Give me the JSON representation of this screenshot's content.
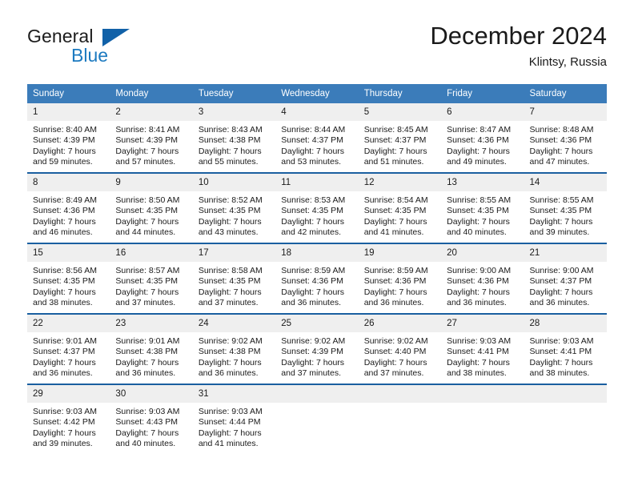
{
  "brand": {
    "name_part1": "General",
    "name_part2": "Blue",
    "colors": {
      "text": "#1c1c1c",
      "blue": "#1c7ac0",
      "triangle": "#1161a8"
    }
  },
  "header": {
    "title": "December 2024",
    "subtitle": "Klintsy, Russia"
  },
  "theme": {
    "header_bg": "#3b7cba",
    "row_divider": "#1a5fa0",
    "daynum_bg": "#efefef"
  },
  "weekdays": [
    "Sunday",
    "Monday",
    "Tuesday",
    "Wednesday",
    "Thursday",
    "Friday",
    "Saturday"
  ],
  "weeks": [
    {
      "days": [
        {
          "num": "1",
          "sunrise": "Sunrise: 8:40 AM",
          "sunset": "Sunset: 4:39 PM",
          "daylight1": "Daylight: 7 hours",
          "daylight2": "and 59 minutes."
        },
        {
          "num": "2",
          "sunrise": "Sunrise: 8:41 AM",
          "sunset": "Sunset: 4:39 PM",
          "daylight1": "Daylight: 7 hours",
          "daylight2": "and 57 minutes."
        },
        {
          "num": "3",
          "sunrise": "Sunrise: 8:43 AM",
          "sunset": "Sunset: 4:38 PM",
          "daylight1": "Daylight: 7 hours",
          "daylight2": "and 55 minutes."
        },
        {
          "num": "4",
          "sunrise": "Sunrise: 8:44 AM",
          "sunset": "Sunset: 4:37 PM",
          "daylight1": "Daylight: 7 hours",
          "daylight2": "and 53 minutes."
        },
        {
          "num": "5",
          "sunrise": "Sunrise: 8:45 AM",
          "sunset": "Sunset: 4:37 PM",
          "daylight1": "Daylight: 7 hours",
          "daylight2": "and 51 minutes."
        },
        {
          "num": "6",
          "sunrise": "Sunrise: 8:47 AM",
          "sunset": "Sunset: 4:36 PM",
          "daylight1": "Daylight: 7 hours",
          "daylight2": "and 49 minutes."
        },
        {
          "num": "7",
          "sunrise": "Sunrise: 8:48 AM",
          "sunset": "Sunset: 4:36 PM",
          "daylight1": "Daylight: 7 hours",
          "daylight2": "and 47 minutes."
        }
      ]
    },
    {
      "days": [
        {
          "num": "8",
          "sunrise": "Sunrise: 8:49 AM",
          "sunset": "Sunset: 4:36 PM",
          "daylight1": "Daylight: 7 hours",
          "daylight2": "and 46 minutes."
        },
        {
          "num": "9",
          "sunrise": "Sunrise: 8:50 AM",
          "sunset": "Sunset: 4:35 PM",
          "daylight1": "Daylight: 7 hours",
          "daylight2": "and 44 minutes."
        },
        {
          "num": "10",
          "sunrise": "Sunrise: 8:52 AM",
          "sunset": "Sunset: 4:35 PM",
          "daylight1": "Daylight: 7 hours",
          "daylight2": "and 43 minutes."
        },
        {
          "num": "11",
          "sunrise": "Sunrise: 8:53 AM",
          "sunset": "Sunset: 4:35 PM",
          "daylight1": "Daylight: 7 hours",
          "daylight2": "and 42 minutes."
        },
        {
          "num": "12",
          "sunrise": "Sunrise: 8:54 AM",
          "sunset": "Sunset: 4:35 PM",
          "daylight1": "Daylight: 7 hours",
          "daylight2": "and 41 minutes."
        },
        {
          "num": "13",
          "sunrise": "Sunrise: 8:55 AM",
          "sunset": "Sunset: 4:35 PM",
          "daylight1": "Daylight: 7 hours",
          "daylight2": "and 40 minutes."
        },
        {
          "num": "14",
          "sunrise": "Sunrise: 8:55 AM",
          "sunset": "Sunset: 4:35 PM",
          "daylight1": "Daylight: 7 hours",
          "daylight2": "and 39 minutes."
        }
      ]
    },
    {
      "days": [
        {
          "num": "15",
          "sunrise": "Sunrise: 8:56 AM",
          "sunset": "Sunset: 4:35 PM",
          "daylight1": "Daylight: 7 hours",
          "daylight2": "and 38 minutes."
        },
        {
          "num": "16",
          "sunrise": "Sunrise: 8:57 AM",
          "sunset": "Sunset: 4:35 PM",
          "daylight1": "Daylight: 7 hours",
          "daylight2": "and 37 minutes."
        },
        {
          "num": "17",
          "sunrise": "Sunrise: 8:58 AM",
          "sunset": "Sunset: 4:35 PM",
          "daylight1": "Daylight: 7 hours",
          "daylight2": "and 37 minutes."
        },
        {
          "num": "18",
          "sunrise": "Sunrise: 8:59 AM",
          "sunset": "Sunset: 4:36 PM",
          "daylight1": "Daylight: 7 hours",
          "daylight2": "and 36 minutes."
        },
        {
          "num": "19",
          "sunrise": "Sunrise: 8:59 AM",
          "sunset": "Sunset: 4:36 PM",
          "daylight1": "Daylight: 7 hours",
          "daylight2": "and 36 minutes."
        },
        {
          "num": "20",
          "sunrise": "Sunrise: 9:00 AM",
          "sunset": "Sunset: 4:36 PM",
          "daylight1": "Daylight: 7 hours",
          "daylight2": "and 36 minutes."
        },
        {
          "num": "21",
          "sunrise": "Sunrise: 9:00 AM",
          "sunset": "Sunset: 4:37 PM",
          "daylight1": "Daylight: 7 hours",
          "daylight2": "and 36 minutes."
        }
      ]
    },
    {
      "days": [
        {
          "num": "22",
          "sunrise": "Sunrise: 9:01 AM",
          "sunset": "Sunset: 4:37 PM",
          "daylight1": "Daylight: 7 hours",
          "daylight2": "and 36 minutes."
        },
        {
          "num": "23",
          "sunrise": "Sunrise: 9:01 AM",
          "sunset": "Sunset: 4:38 PM",
          "daylight1": "Daylight: 7 hours",
          "daylight2": "and 36 minutes."
        },
        {
          "num": "24",
          "sunrise": "Sunrise: 9:02 AM",
          "sunset": "Sunset: 4:38 PM",
          "daylight1": "Daylight: 7 hours",
          "daylight2": "and 36 minutes."
        },
        {
          "num": "25",
          "sunrise": "Sunrise: 9:02 AM",
          "sunset": "Sunset: 4:39 PM",
          "daylight1": "Daylight: 7 hours",
          "daylight2": "and 37 minutes."
        },
        {
          "num": "26",
          "sunrise": "Sunrise: 9:02 AM",
          "sunset": "Sunset: 4:40 PM",
          "daylight1": "Daylight: 7 hours",
          "daylight2": "and 37 minutes."
        },
        {
          "num": "27",
          "sunrise": "Sunrise: 9:03 AM",
          "sunset": "Sunset: 4:41 PM",
          "daylight1": "Daylight: 7 hours",
          "daylight2": "and 38 minutes."
        },
        {
          "num": "28",
          "sunrise": "Sunrise: 9:03 AM",
          "sunset": "Sunset: 4:41 PM",
          "daylight1": "Daylight: 7 hours",
          "daylight2": "and 38 minutes."
        }
      ]
    },
    {
      "days": [
        {
          "num": "29",
          "sunrise": "Sunrise: 9:03 AM",
          "sunset": "Sunset: 4:42 PM",
          "daylight1": "Daylight: 7 hours",
          "daylight2": "and 39 minutes."
        },
        {
          "num": "30",
          "sunrise": "Sunrise: 9:03 AM",
          "sunset": "Sunset: 4:43 PM",
          "daylight1": "Daylight: 7 hours",
          "daylight2": "and 40 minutes."
        },
        {
          "num": "31",
          "sunrise": "Sunrise: 9:03 AM",
          "sunset": "Sunset: 4:44 PM",
          "daylight1": "Daylight: 7 hours",
          "daylight2": "and 41 minutes."
        },
        {
          "num": "",
          "sunrise": "",
          "sunset": "",
          "daylight1": "",
          "daylight2": ""
        },
        {
          "num": "",
          "sunrise": "",
          "sunset": "",
          "daylight1": "",
          "daylight2": ""
        },
        {
          "num": "",
          "sunrise": "",
          "sunset": "",
          "daylight1": "",
          "daylight2": ""
        },
        {
          "num": "",
          "sunrise": "",
          "sunset": "",
          "daylight1": "",
          "daylight2": ""
        }
      ]
    }
  ]
}
